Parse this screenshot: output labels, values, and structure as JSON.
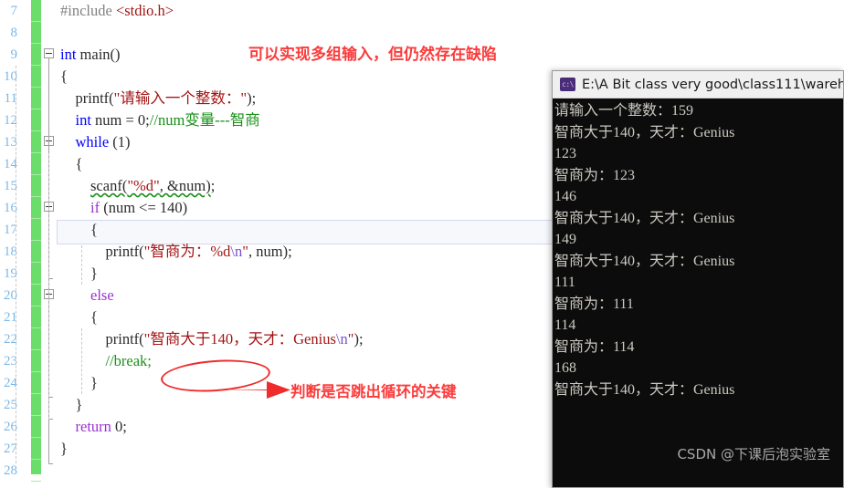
{
  "editor": {
    "line_numbers": [
      "7",
      "8",
      "9",
      "10",
      "11",
      "12",
      "13",
      "14",
      "15",
      "16",
      "17",
      "18",
      "19",
      "20",
      "21",
      "22",
      "23",
      "24",
      "25",
      "26",
      "27",
      "28"
    ],
    "code_lines": [
      {
        "n": "7",
        "text": "#include <stdio.h>"
      },
      {
        "n": "8",
        "text": ""
      },
      {
        "n": "9",
        "text": "int main()"
      },
      {
        "n": "10",
        "text": "{"
      },
      {
        "n": "11",
        "text": "    printf(\"请输入一个整数：\");"
      },
      {
        "n": "12",
        "text": "    int num = 0;//num变量---智商"
      },
      {
        "n": "13",
        "text": "    while (1)"
      },
      {
        "n": "14",
        "text": "    {"
      },
      {
        "n": "15",
        "text": "        scanf(\"%d\", &num);"
      },
      {
        "n": "16",
        "text": "        if (num <= 140)"
      },
      {
        "n": "17",
        "text": "        {"
      },
      {
        "n": "18",
        "text": "            printf(\"智商为：%d\\n\", num);"
      },
      {
        "n": "19",
        "text": "        }"
      },
      {
        "n": "20",
        "text": "        else"
      },
      {
        "n": "21",
        "text": "        {"
      },
      {
        "n": "22",
        "text": "            printf(\"智商大于140，天才：Genius\\n\");"
      },
      {
        "n": "23",
        "text": "            //break;"
      },
      {
        "n": "24",
        "text": "        }"
      },
      {
        "n": "25",
        "text": "    }"
      },
      {
        "n": "26",
        "text": "    return 0;"
      },
      {
        "n": "27",
        "text": "}"
      },
      {
        "n": "28",
        "text": ""
      }
    ]
  },
  "annotations": {
    "top": "可以实现多组输入，但仍然存在缺陷",
    "bottom": "判断是否跳出循环的关键",
    "color": "#fb3b3b"
  },
  "console": {
    "icon": "command-prompt-icon",
    "icon_glyph": "c:\\",
    "title": "E:\\A Bit class very good\\class111\\wareh",
    "output_lines": [
      "请输入一个整数：159",
      "智商大于140，天才：Genius",
      "123",
      "智商为：123",
      "146",
      "智商大于140，天才：Genius",
      "149",
      "智商大于140，天才：Genius",
      "111",
      "智商为：111",
      "114",
      "智商为：114",
      "168",
      "智商大于140，天才：Genius"
    ],
    "background": "#0c0c0c",
    "text_color": "#ccc9c1"
  },
  "watermark": {
    "text": "CSDN @下课后泡实验室"
  }
}
